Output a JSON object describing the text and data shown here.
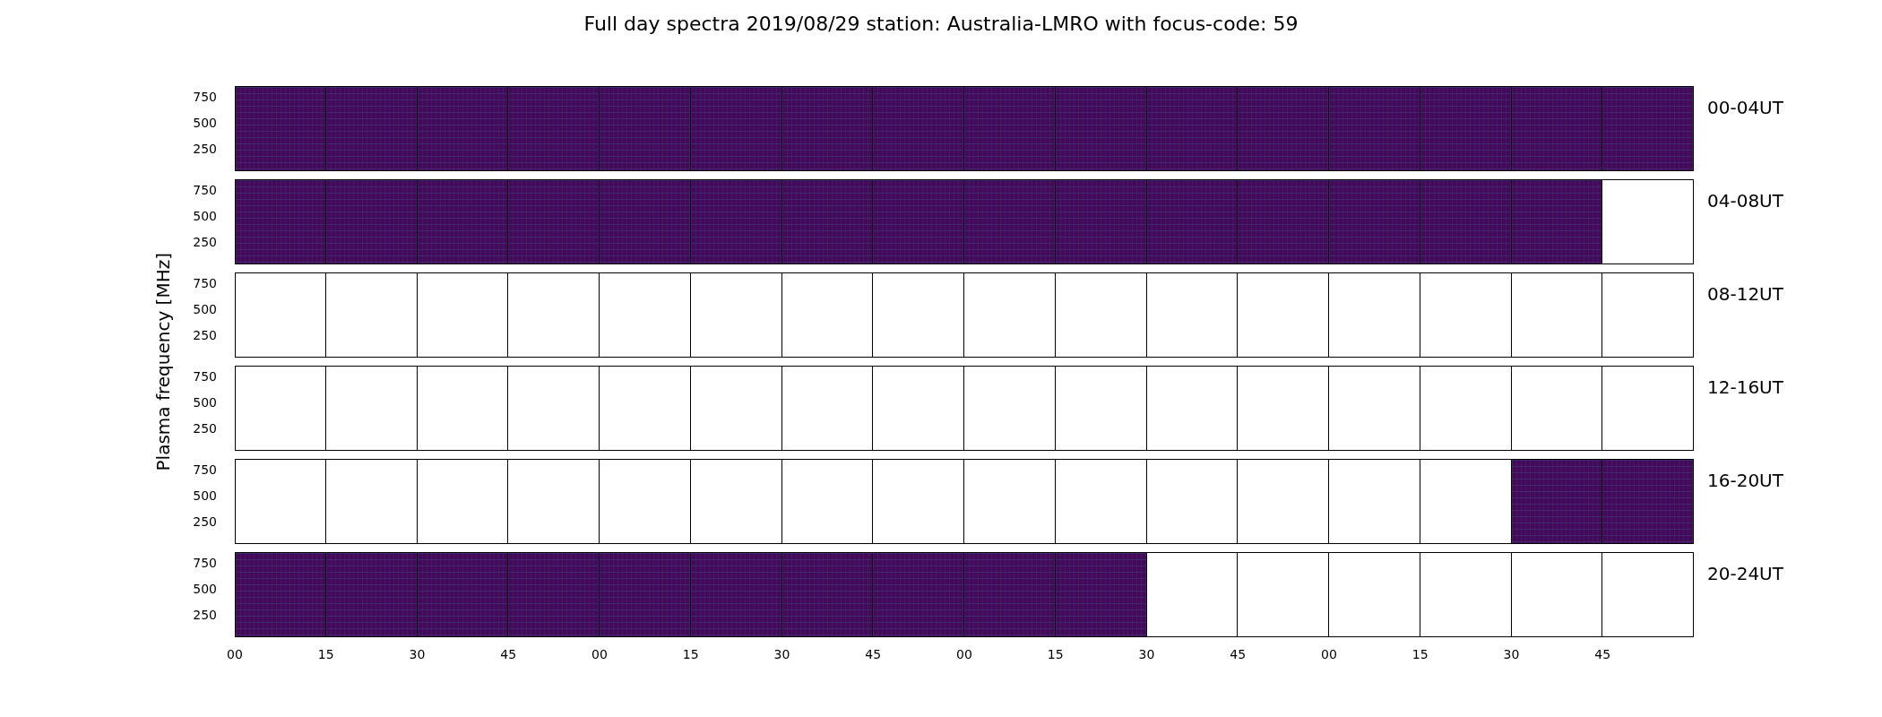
{
  "title": "Full day spectra 2019/08/29 station: Australia-LMRO with focus-code: 59",
  "ylabel": "Plasma frequency [MHz]",
  "rows": [
    {
      "label": "00-04UT",
      "yticks": [
        "750",
        "500",
        "250"
      ],
      "panels": [
        {
          "has_data": true
        },
        {
          "has_data": true
        },
        {
          "has_data": true
        },
        {
          "has_data": true
        },
        {
          "has_data": true
        },
        {
          "has_data": true
        },
        {
          "has_data": true
        },
        {
          "has_data": true
        },
        {
          "has_data": true
        },
        {
          "has_data": true
        },
        {
          "has_data": true
        },
        {
          "has_data": true
        },
        {
          "has_data": true
        },
        {
          "has_data": true
        },
        {
          "has_data": true
        },
        {
          "has_data": true
        }
      ]
    },
    {
      "label": "04-08UT",
      "yticks": [
        "750",
        "500",
        "250"
      ],
      "panels": [
        {
          "has_data": true
        },
        {
          "has_data": true
        },
        {
          "has_data": true
        },
        {
          "has_data": true
        },
        {
          "has_data": true
        },
        {
          "has_data": true
        },
        {
          "has_data": true
        },
        {
          "has_data": true
        },
        {
          "has_data": true
        },
        {
          "has_data": true
        },
        {
          "has_data": true
        },
        {
          "has_data": true
        },
        {
          "has_data": true
        },
        {
          "has_data": true
        },
        {
          "has_data": true
        },
        {
          "has_data": false
        }
      ]
    },
    {
      "label": "08-12UT",
      "yticks": [
        "750",
        "500",
        "250"
      ],
      "panels": [
        {
          "has_data": false
        },
        {
          "has_data": false
        },
        {
          "has_data": false
        },
        {
          "has_data": false
        },
        {
          "has_data": false
        },
        {
          "has_data": false
        },
        {
          "has_data": false
        },
        {
          "has_data": false
        },
        {
          "has_data": false
        },
        {
          "has_data": false
        },
        {
          "has_data": false
        },
        {
          "has_data": false
        },
        {
          "has_data": false
        },
        {
          "has_data": false
        },
        {
          "has_data": false
        },
        {
          "has_data": false
        }
      ]
    },
    {
      "label": "12-16UT",
      "yticks": [
        "750",
        "500",
        "250"
      ],
      "panels": [
        {
          "has_data": false
        },
        {
          "has_data": false
        },
        {
          "has_data": false
        },
        {
          "has_data": false
        },
        {
          "has_data": false
        },
        {
          "has_data": false
        },
        {
          "has_data": false
        },
        {
          "has_data": false
        },
        {
          "has_data": false
        },
        {
          "has_data": false
        },
        {
          "has_data": false
        },
        {
          "has_data": false
        },
        {
          "has_data": false
        },
        {
          "has_data": false
        },
        {
          "has_data": false
        },
        {
          "has_data": false
        }
      ]
    },
    {
      "label": "16-20UT",
      "yticks": [
        "750",
        "500",
        "250"
      ],
      "panels": [
        {
          "has_data": false
        },
        {
          "has_data": false
        },
        {
          "has_data": false
        },
        {
          "has_data": false
        },
        {
          "has_data": false
        },
        {
          "has_data": false
        },
        {
          "has_data": false
        },
        {
          "has_data": false
        },
        {
          "has_data": false
        },
        {
          "has_data": false
        },
        {
          "has_data": false
        },
        {
          "has_data": false
        },
        {
          "has_data": false
        },
        {
          "has_data": false
        },
        {
          "has_data": true
        },
        {
          "has_data": true
        }
      ]
    },
    {
      "label": "20-24UT",
      "yticks": [
        "750",
        "500",
        "250"
      ],
      "panels": [
        {
          "has_data": true
        },
        {
          "has_data": true
        },
        {
          "has_data": true
        },
        {
          "has_data": true
        },
        {
          "has_data": true
        },
        {
          "has_data": true
        },
        {
          "has_data": true
        },
        {
          "has_data": true
        },
        {
          "has_data": true
        },
        {
          "has_data": true
        },
        {
          "has_data": false
        },
        {
          "has_data": false
        },
        {
          "has_data": false
        },
        {
          "has_data": false
        },
        {
          "has_data": false
        },
        {
          "has_data": false
        }
      ]
    }
  ],
  "xticks": [
    "00",
    "15",
    "30",
    "45",
    "00",
    "15",
    "30",
    "45",
    "00",
    "15",
    "30",
    "45",
    "00",
    "15",
    "30",
    "45"
  ]
}
